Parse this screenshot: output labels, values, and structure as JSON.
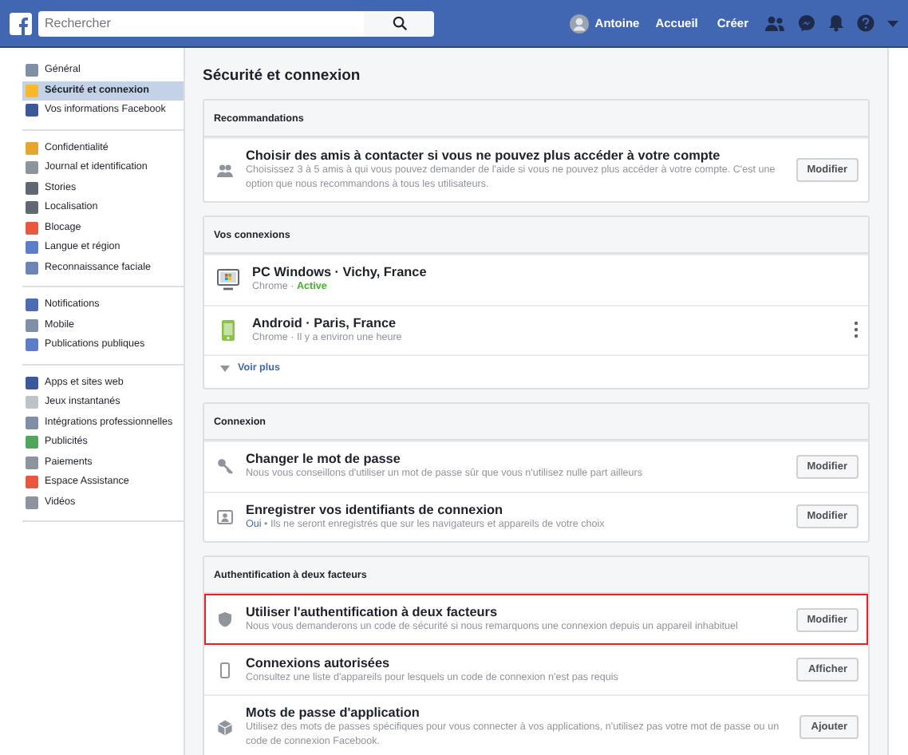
{
  "topbar": {
    "search": {
      "placeholder": "Rechercher"
    },
    "user": "Antoine",
    "links": [
      "Accueil",
      "Créer"
    ]
  },
  "sidebar": {
    "groups": [
      {
        "items": [
          {
            "label": "Général",
            "selected": false
          },
          {
            "label": "Sécurité et connexion",
            "selected": true
          },
          {
            "label": "Vos informations Facebook",
            "selected": false
          }
        ]
      },
      {
        "items": [
          {
            "label": "Confidentialité",
            "selected": false
          },
          {
            "label": "Journal et identification",
            "selected": false
          },
          {
            "label": "Stories",
            "selected": false
          },
          {
            "label": "Localisation",
            "selected": false
          },
          {
            "label": "Blocage",
            "selected": false
          },
          {
            "label": "Langue et région",
            "selected": false
          },
          {
            "label": "Reconnaissance faciale",
            "selected": false
          }
        ]
      },
      {
        "items": [
          {
            "label": "Notifications",
            "selected": false
          },
          {
            "label": "Mobile",
            "selected": false
          },
          {
            "label": "Publications publiques",
            "selected": false
          }
        ]
      },
      {
        "items": [
          {
            "label": "Apps et sites web",
            "selected": false
          },
          {
            "label": "Jeux instantanés",
            "selected": false
          },
          {
            "label": "Intégrations professionnelles",
            "selected": false
          },
          {
            "label": "Publicités",
            "selected": false
          },
          {
            "label": "Paiements",
            "selected": false
          },
          {
            "label": "Espace Assistance",
            "selected": false
          },
          {
            "label": "Vidéos",
            "selected": false
          }
        ]
      }
    ]
  },
  "page_title": "Sécurité et connexion",
  "sections": [
    {
      "title": "Recommandations",
      "rows": [
        {
          "kind": "setting",
          "title": "Choisir des amis à contacter si vous ne pouvez plus accéder à votre compte",
          "desc": [
            {
              "text": "Choisissez 3 à 5 amis à qui vous pouvez demander de l'aide si vous ne pouvez plus accéder à votre compte. C'est une option que nous recommandons à tous les utilisateurs."
            }
          ],
          "button": "Modifier",
          "highlighted": false
        }
      ]
    },
    {
      "title": "Vos connexions",
      "rows": [
        {
          "kind": "device",
          "title": "PC Windows · Vichy, France",
          "desc": [
            {
              "text": "Chrome · "
            },
            {
              "text": "Active",
              "kind": "active"
            }
          ],
          "has_menu": false
        },
        {
          "kind": "device",
          "title": "Android · Paris, France",
          "desc": [
            {
              "text": "Chrome · Il y a environ une heure"
            }
          ],
          "has_menu": true
        },
        {
          "kind": "more",
          "title": "Voir plus"
        }
      ]
    },
    {
      "title": "Connexion",
      "rows": [
        {
          "kind": "setting",
          "title": "Changer le mot de passe",
          "desc": [
            {
              "text": "Nous vous conseillons d'utiliser un mot de passe sûr que vous n'utilisez nulle part ailleurs"
            }
          ],
          "button": "Modifier",
          "highlighted": false
        },
        {
          "kind": "setting",
          "title": "Enregistrer vos identifiants de connexion",
          "desc": [
            {
              "text": "Oui",
              "kind": "link"
            },
            {
              "text": " • Ils ne seront enregistrés que sur les navigateurs et appareils de votre choix"
            }
          ],
          "button": "Modifier",
          "highlighted": false
        }
      ]
    },
    {
      "title": "Authentification à deux facteurs",
      "rows": [
        {
          "kind": "setting",
          "title": "Utiliser l'authentification à deux facteurs",
          "desc": [
            {
              "text": "Nous vous demanderons un code de sécurité si nous remarquons une connexion depuis un appareil inhabituel"
            }
          ],
          "button": "Modifier",
          "highlighted": true
        },
        {
          "kind": "setting",
          "title": "Connexions autorisées",
          "desc": [
            {
              "text": "Consultez une liste d'appareils pour lesquels un code de connexion n'est pas requis"
            }
          ],
          "button": "Afficher",
          "highlighted": false
        },
        {
          "kind": "setting",
          "title": "Mots de passe d'application",
          "desc": [
            {
              "text": "Utilisez des mots de passes spécifiques pour vous connecter à vos applications, n'utilisez pas votre mot de passe ou un code de connexion Facebook."
            }
          ],
          "button": "Ajouter",
          "highlighted": false
        }
      ]
    }
  ]
}
